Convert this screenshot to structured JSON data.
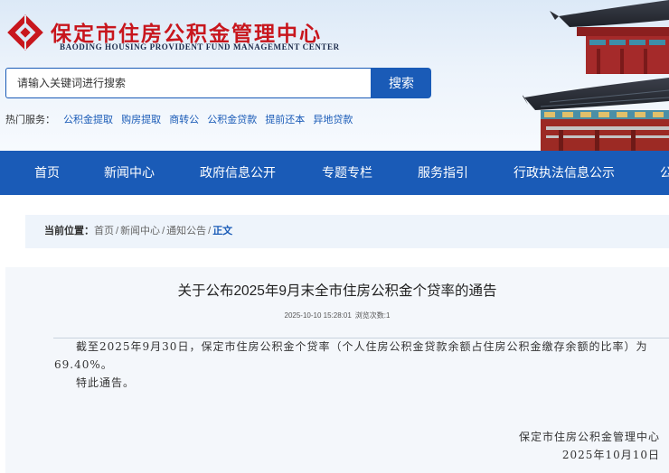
{
  "header": {
    "title": "保定市住房公积金管理中心",
    "subtitle": "BAODING HOUSING PROVIDENT FUND MANAGEMENT CENTER",
    "brand_color": "#c8161d"
  },
  "search": {
    "placeholder": "请输入关键词进行搜索",
    "button_label": "搜索"
  },
  "hot_services": {
    "label": "热门服务：",
    "links": [
      "公积金提取",
      "购房提取",
      "商转公",
      "公积金贷款",
      "提前还本",
      "异地贷款"
    ]
  },
  "nav": {
    "items": [
      "首页",
      "新闻中心",
      "政府信息公开",
      "专题专栏",
      "服务指引",
      "行政执法信息公示",
      "公"
    ],
    "background": "#1a5bb7"
  },
  "breadcrumb": {
    "label": "当前位置：",
    "items": [
      "首页",
      "新闻中心",
      "通知公告"
    ],
    "separator": "/",
    "current": "正文"
  },
  "article": {
    "title": "关于公布2025年9月末全市住房公积金个贷率的通告",
    "datetime": "2025-10-10 15:28:01",
    "views_label": "浏览次数:",
    "views": "1",
    "paragraphs": [
      "截至2025年9月30日，保定市住房公积金个贷率（个人住房公积金贷款余额占住房公积金缴存余额的比率）为69.40%。",
      "特此通告。"
    ],
    "signature": "保定市住房公积金管理中心",
    "date": "2025年10月10日"
  }
}
